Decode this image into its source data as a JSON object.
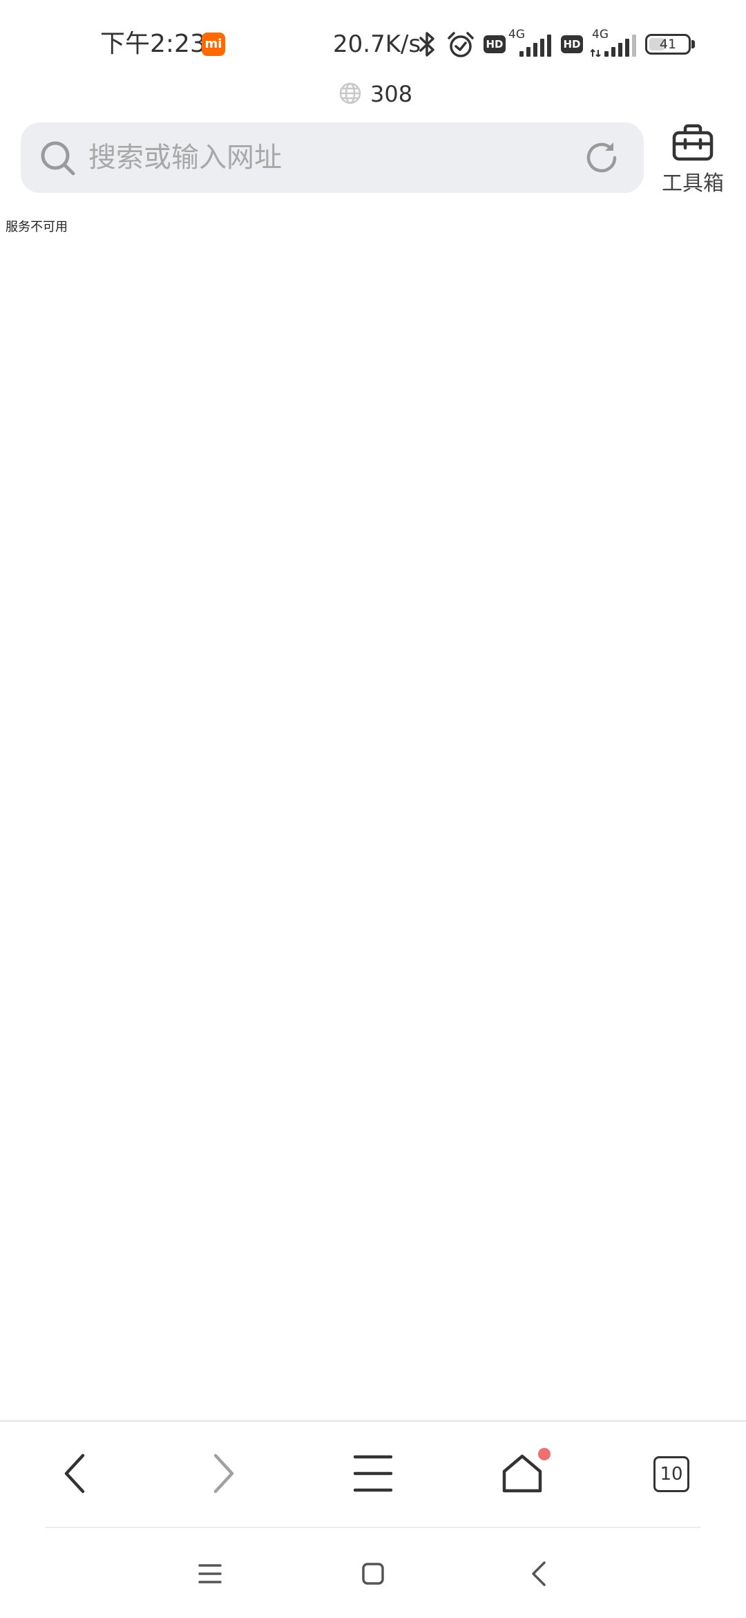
{
  "status_bar": {
    "time": "下午2:23",
    "mi_badge": "mi",
    "network_speed": "20.7K/s",
    "sim1_hd": "HD",
    "sim1_network": "4G",
    "sim2_hd": "HD",
    "sim2_network": "4G",
    "battery_level": "41",
    "battery_fraction": 0.41
  },
  "counter": {
    "value": "308"
  },
  "address_bar": {
    "placeholder": "搜索或输入网址",
    "value": ""
  },
  "toolbox": {
    "label": "工具箱"
  },
  "page": {
    "error_message": "服务不可用"
  },
  "bottom_toolbar": {
    "tabs_count": "10",
    "home_has_notification": true
  },
  "colors": {
    "accent_mi": "#ff6a00",
    "notification_dot": "#f07070",
    "address_bar_bg": "#eceef2",
    "placeholder": "#a8a8a8"
  },
  "icons": [
    "bluetooth-icon",
    "alarm-icon",
    "signal-icon",
    "battery-icon",
    "globe-icon",
    "search-icon",
    "reload-icon",
    "toolbox-icon",
    "back-icon",
    "forward-icon",
    "menu-icon",
    "home-icon",
    "tabs-icon",
    "recents-icon",
    "square-home-icon"
  ]
}
